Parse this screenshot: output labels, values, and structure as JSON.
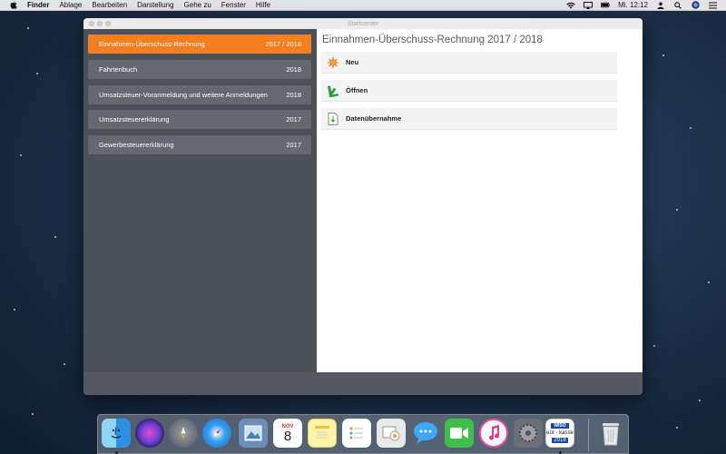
{
  "menubar": {
    "app_name": "Finder",
    "items": [
      "Ablage",
      "Bearbeiten",
      "Darstellung",
      "Gehe zu",
      "Fenster",
      "Hilfe"
    ],
    "clock": "Mi. 12:12"
  },
  "window": {
    "title": "Startcenter"
  },
  "sidebar": {
    "items": [
      {
        "label": "Einnahmen-Überschuss-Rechnung",
        "year": "2017 / 2018",
        "active": true
      },
      {
        "label": "Fahrtenbuch",
        "year": "2018"
      },
      {
        "label": "Umsatzsteuer-Voranmeldung und weitere Anmeldungen",
        "year": "2018"
      },
      {
        "label": "Umsatzsteuererklärung",
        "year": "2017"
      },
      {
        "label": "Gewerbesteuererklärung",
        "year": "2017"
      }
    ]
  },
  "main": {
    "title": "Einnahmen-Überschuss-Rechnung 2017 / 2018",
    "actions": [
      {
        "label": "Neu",
        "icon": "new-star-icon"
      },
      {
        "label": "Öffnen",
        "icon": "open-arrow-icon"
      },
      {
        "label": "Datenübernahme",
        "icon": "data-import-icon"
      }
    ]
  },
  "dock": {
    "apps": [
      "Finder",
      "Siri",
      "Launchpad",
      "Safari",
      "Vorschau",
      "Kalender",
      "Notizen",
      "Erinnerungen",
      "Fotos",
      "Nachrichten",
      "FaceTime",
      "iTunes",
      "Systemeinstellungen",
      "WISO EÜR & Kasse 2018",
      "Papierkorb"
    ],
    "calendar_month": "NOV",
    "calendar_day": "8",
    "wiso_brand": "WISO",
    "wiso_label": "eür · kasse",
    "wiso_year": "2018"
  },
  "colors": {
    "accent": "#f57e20",
    "sidebar_bg": "#4c5058",
    "sidebar_item": "#656870",
    "main_bg": "#ffffff"
  }
}
